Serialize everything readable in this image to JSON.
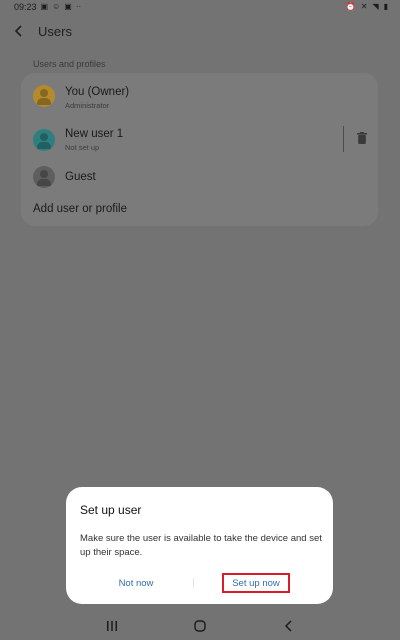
{
  "status_bar": {
    "time": "09:23",
    "left_icons": [
      "image-icon",
      "smiley-icon",
      "photo-icon",
      "dots-icon"
    ],
    "right_icons": [
      "alarm-icon",
      "mute-icon",
      "wifi-icon",
      "battery-icon"
    ]
  },
  "header": {
    "title": "Users"
  },
  "section": {
    "label": "Users and profiles"
  },
  "users": [
    {
      "name": "You (Owner)",
      "subtitle": "Administrator",
      "avatar_color": "#b38a2c"
    },
    {
      "name": "New user 1",
      "subtitle": "Not set up",
      "avatar_color": "#2d7f80"
    },
    {
      "name": "Guest",
      "subtitle": "",
      "avatar_color": "#5e5e5e"
    }
  ],
  "add_user_label": "Add user or profile",
  "dialog": {
    "title": "Set up user",
    "message": "Make sure the user is available to take the device and set up their space.",
    "negative_button": "Not now",
    "positive_button": "Set up now",
    "highlight_color": "#d81d2a"
  },
  "navbar": {
    "icons": [
      "recents-icon",
      "home-icon",
      "back-icon"
    ]
  }
}
